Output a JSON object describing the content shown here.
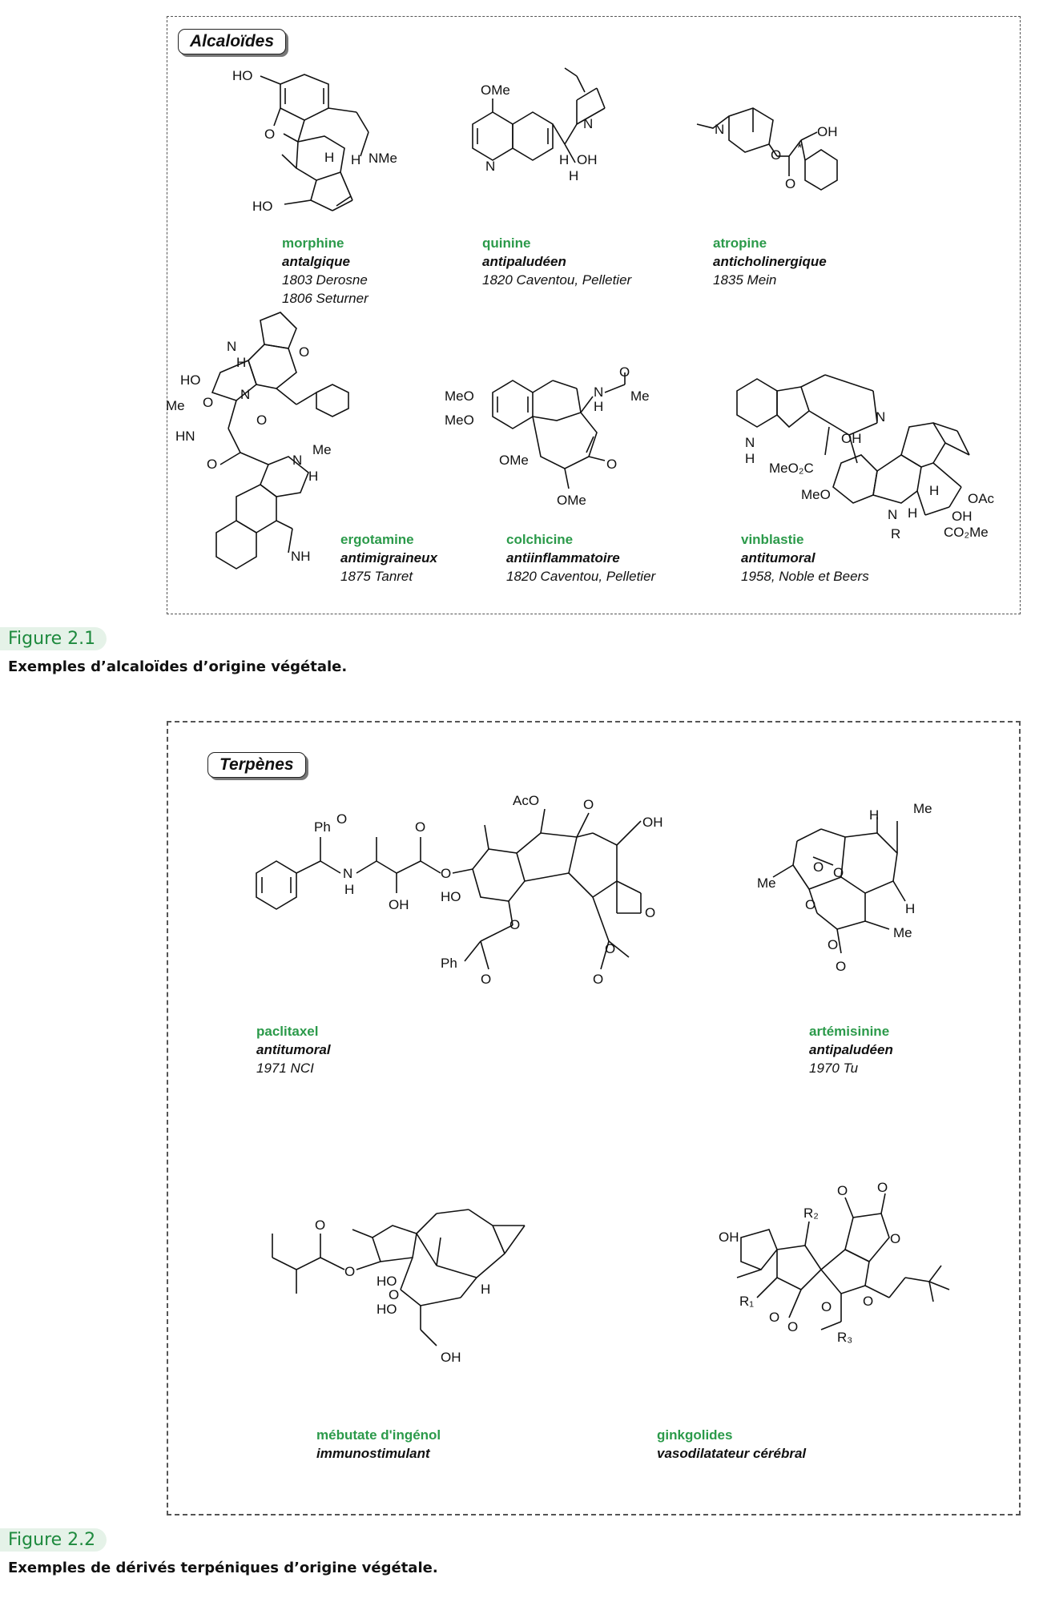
{
  "figure1": {
    "tag": "Alcaloïdes",
    "compounds": [
      {
        "name": "morphine",
        "activity": "antalgique",
        "dates": [
          "1803 Derosne",
          "1806 Seturner"
        ],
        "atoms": [
          "HO",
          "O",
          "H",
          "H",
          "NMe",
          "HO"
        ]
      },
      {
        "name": "quinine",
        "activity": "antipaludéen",
        "dates": [
          "1820 Caventou, Pelletier"
        ],
        "atoms": [
          "OMe",
          "N",
          "N",
          "H",
          "OH",
          "H"
        ]
      },
      {
        "name": "atropine",
        "activity": "anticholinergique",
        "dates": [
          "1835 Mein"
        ],
        "atoms": [
          "N",
          "OH",
          "O",
          "O",
          "*"
        ]
      },
      {
        "name": "ergotamine",
        "activity": "antimigraineux",
        "dates": [
          "1875 Tanret"
        ],
        "atoms": [
          "H",
          "N",
          "O",
          "HO",
          "O",
          "Me",
          "N",
          "HN",
          "O",
          "O",
          "N",
          "Me",
          "H",
          "NH"
        ]
      },
      {
        "name": "colchicine",
        "activity": "antiinflammatoire",
        "dates": [
          "1820 Caventou, Pelletier"
        ],
        "atoms": [
          "MeO",
          "MeO",
          "OMe",
          "N",
          "H",
          "Me",
          "O",
          "O",
          "OMe"
        ]
      },
      {
        "name": "vinblastie",
        "activity": "antitumoral",
        "dates": [
          "1958, Noble et Beers"
        ],
        "atoms": [
          "N",
          "H",
          "N",
          "OH",
          "MeO₂C",
          "MeO",
          "N",
          "H",
          "R",
          "H",
          "OAc",
          "OH",
          "CO₂Me"
        ]
      }
    ],
    "figure_number": "Figure 2.1",
    "caption": "Exemples d’alcaloïdes d’origine végétale."
  },
  "figure2": {
    "tag": "Terpènes",
    "compounds": [
      {
        "name": "paclitaxel",
        "activity": "antitumoral",
        "dates": [
          "1971 NCI"
        ],
        "atoms": [
          "O",
          "Ph",
          "N",
          "H",
          "OH",
          "O",
          "O",
          "AcO",
          "O",
          "OH",
          "HO",
          "Ph",
          "O",
          "O",
          "O",
          "O",
          "O"
        ]
      },
      {
        "name": "artémisinine",
        "activity": "antipaludéen",
        "dates": [
          "1970 Tu"
        ],
        "atoms": [
          "Me",
          "H",
          "Me",
          "O",
          "O",
          "O",
          "O",
          "O",
          "H",
          "Me"
        ]
      },
      {
        "name": "mébutate d'ingénol",
        "activity": "immunostimulant",
        "dates": [],
        "atoms": [
          "O",
          "O",
          "O",
          "HO",
          "HO",
          "H",
          "OH"
        ]
      },
      {
        "name": "ginkgolides",
        "activity": "vasodilatateur cérébral",
        "dates": [],
        "atoms": [
          "OH",
          "O",
          "R₂",
          "O",
          "O",
          "R₁",
          "O",
          "O",
          "O",
          "O",
          "R₃"
        ]
      }
    ],
    "figure_number": "Figure 2.2",
    "caption": "Exemples de dérivés terpéniques d’origine végétale."
  },
  "colors": {
    "compound_name": "#2b9a4a",
    "figure_tag_bg": "#e5f2e8",
    "figure_tag_text": "#1e8a3e"
  }
}
